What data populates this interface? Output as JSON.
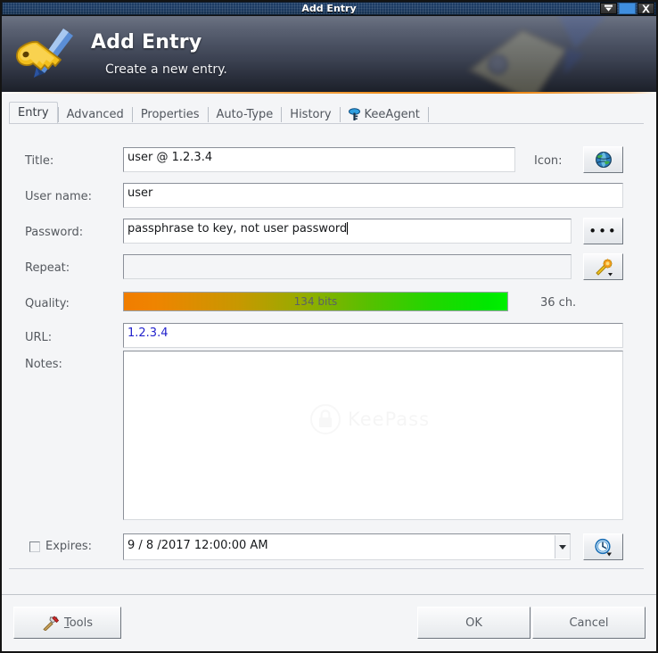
{
  "window": {
    "title": "Add Entry",
    "controls": [
      {
        "name": "minimize-button",
        "glyph": "minimize-icon"
      },
      {
        "name": "maximize-button",
        "glyph": "maximize-icon"
      },
      {
        "name": "close-button",
        "glyph": "close-icon"
      }
    ]
  },
  "banner": {
    "title": "Add Entry",
    "subtitle": "Create a new entry.",
    "icon": "key-with-pen-icon"
  },
  "tabs": [
    {
      "label": "Entry",
      "selected": true,
      "icon": null
    },
    {
      "label": "Advanced",
      "selected": false,
      "icon": null
    },
    {
      "label": "Properties",
      "selected": false,
      "icon": null
    },
    {
      "label": "Auto-Type",
      "selected": false,
      "icon": null
    },
    {
      "label": "History",
      "selected": false,
      "icon": null
    },
    {
      "label": "KeeAgent",
      "selected": false,
      "icon": "keeagent-key-icon"
    }
  ],
  "form": {
    "title": {
      "label": "Title:",
      "value": "user @ 1.2.3.4",
      "placeholder": ""
    },
    "icon": {
      "label": "Icon:",
      "button_icon": "globe-icon"
    },
    "username": {
      "label": "User name:",
      "value": "user",
      "placeholder": ""
    },
    "password": {
      "label": "Password:",
      "value": "passphrase to key, not user password",
      "placeholder": "",
      "toggle_label": "•••"
    },
    "repeat": {
      "label": "Repeat:",
      "value": "",
      "placeholder": "",
      "generate_icon": "key-generator-icon"
    },
    "quality": {
      "label": "Quality:",
      "bits_text": "134 bits",
      "chars_text": "36 ch.",
      "bits": 134,
      "chars": 36,
      "gradient_start": "#f07d00",
      "gradient_end": "#00f000"
    },
    "url": {
      "label": "URL:",
      "value": "1.2.3.4",
      "placeholder": ""
    },
    "notes": {
      "label": "Notes:",
      "value": "",
      "placeholder": ""
    },
    "expires": {
      "label": "Expires:",
      "checked": false,
      "value": "9 / 8 /2017 12:00:00 AM",
      "picker_icon": "clock-icon"
    }
  },
  "watermark": {
    "text": "KeePass",
    "icon": "lock-icon"
  },
  "footer": {
    "tools_label_prefix": "",
    "tools_accel": "T",
    "tools_label_rest": "ools",
    "tools_icon": "hammer-wrench-icon",
    "ok_label": "OK",
    "cancel_label": "Cancel"
  }
}
